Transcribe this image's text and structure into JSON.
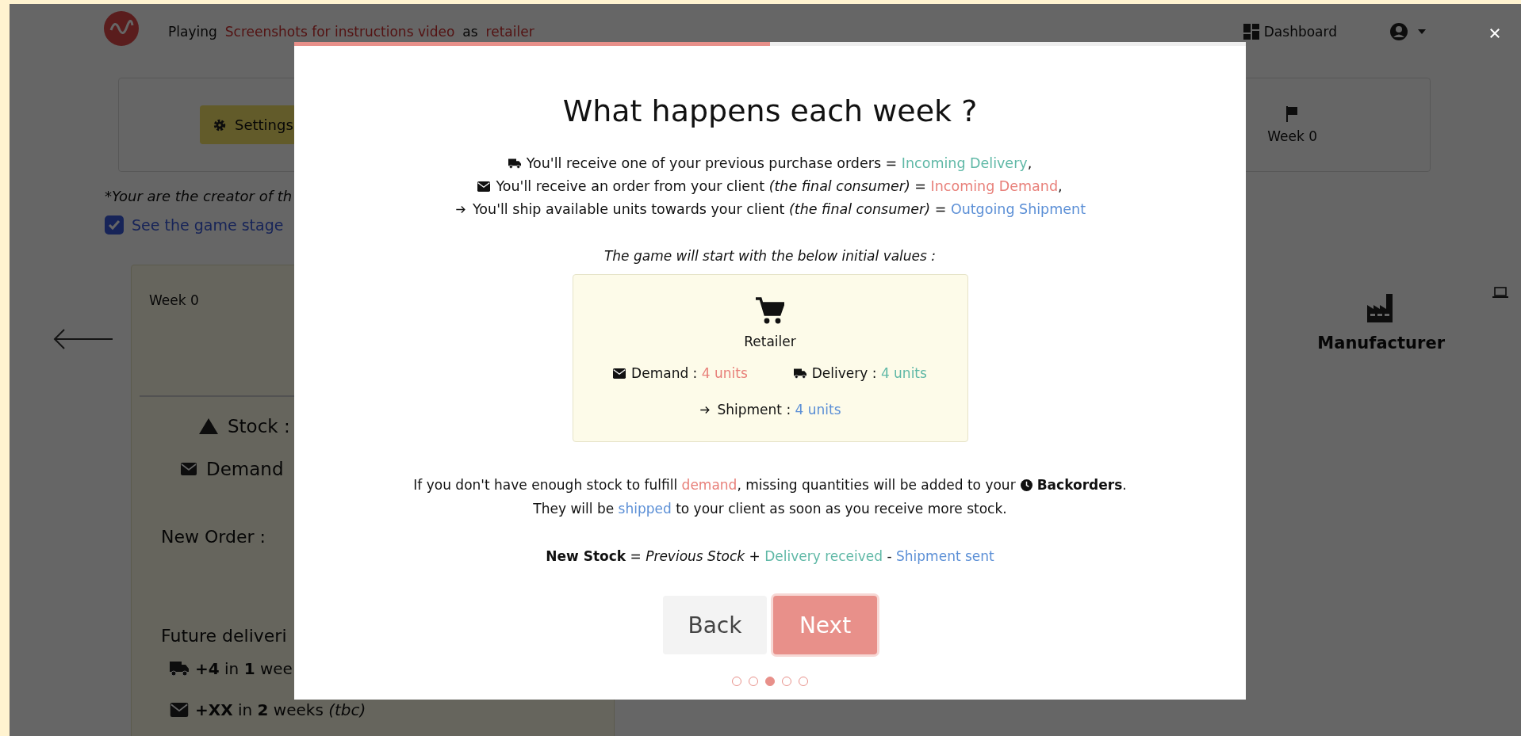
{
  "header": {
    "prefix": "Playing",
    "game": "Screenshots for instructions video",
    "joiner": "as",
    "role": "retailer",
    "dashboard": "Dashboard"
  },
  "settings_card": {
    "button": "Settings",
    "week": "Week 0"
  },
  "creator_note": "*Your are the creator of th",
  "stage_checkbox": {
    "label": "See the game stage",
    "checked": true
  },
  "game_card": {
    "week": "Week 0",
    "stock": "Stock :",
    "demand": "Demand",
    "new_order": "New Order :",
    "future": "Future deliveri",
    "deliveries": [
      {
        "kind": "truck",
        "text": "**+4** in **1** wee"
      },
      {
        "kind": "mail",
        "text": "**+XX** in **2** weeks *(tbc)*"
      }
    ]
  },
  "next_role": "Manufacturer",
  "modal": {
    "progress": {
      "level": 0.5
    },
    "title": "What happens each week ?",
    "events": [
      {
        "kind": "truck",
        "segments": [
          {
            "kind": "plain",
            "text": "You'll receive one of your previous purchase orders = "
          },
          {
            "kind": "delivery",
            "text": "Incoming Delivery"
          },
          {
            "kind": "plain",
            "text": ","
          }
        ]
      },
      {
        "kind": "mail",
        "segments": [
          {
            "kind": "plain",
            "text": "You'll receive an order from your client "
          },
          {
            "kind": "italic",
            "text": "(the final consumer)"
          },
          {
            "kind": "plain",
            "text": " = "
          },
          {
            "kind": "demand",
            "text": "Incoming Demand"
          },
          {
            "kind": "plain",
            "text": ","
          }
        ]
      },
      {
        "kind": "arrow",
        "segments": [
          {
            "kind": "plain",
            "text": "You'll ship available units towards your client "
          },
          {
            "kind": "italic",
            "text": "(the final consumer)"
          },
          {
            "kind": "plain",
            "text": " = "
          },
          {
            "kind": "shipment",
            "text": "Outgoing Shipment"
          }
        ]
      }
    ],
    "caption": "The game will start with the below initial values :",
    "initial": {
      "role": "Retailer",
      "values": [
        {
          "kind": "mail",
          "segments": [
            {
              "kind": "plain",
              "text": "Demand : "
            },
            {
              "kind": "demand",
              "text": "4 units"
            }
          ]
        },
        {
          "kind": "truck",
          "segments": [
            {
              "kind": "plain",
              "text": "Delivery : "
            },
            {
              "kind": "delivery",
              "text": "4 units"
            }
          ]
        },
        {
          "kind": "arrow",
          "segments": [
            {
              "kind": "plain",
              "text": "Shipment : "
            },
            {
              "kind": "shipment",
              "text": "4 units"
            }
          ]
        }
      ]
    },
    "backorder_lead": [
      {
        "kind": "plain",
        "text": "If you don't have enough stock to fulfill "
      },
      {
        "kind": "demand",
        "text": "demand"
      },
      {
        "kind": "plain",
        "text": ", missing quantities will be added to your"
      }
    ],
    "backorder_term": [
      {
        "kind": "strong",
        "text": "Backorders"
      },
      {
        "kind": "plain",
        "text": "."
      }
    ],
    "shipped_line": [
      {
        "kind": "plain",
        "text": "They will be "
      },
      {
        "kind": "shipment",
        "text": "shipped"
      },
      {
        "kind": "plain",
        "text": " to your client as soon as you receive more stock."
      }
    ],
    "formula": [
      {
        "kind": "strong",
        "text": "New Stock"
      },
      {
        "kind": "plain",
        "text": " = "
      },
      {
        "kind": "italic",
        "text": "Previous Stock"
      },
      {
        "kind": "plain",
        "text": " + "
      },
      {
        "kind": "delivery",
        "text": "Delivery received"
      },
      {
        "kind": "plain",
        "text": " - "
      },
      {
        "kind": "shipment",
        "text": "Shipment sent"
      }
    ],
    "back": "Back",
    "next": "Next",
    "steps": [
      {
        "selected": false
      },
      {
        "selected": false
      },
      {
        "selected": true
      },
      {
        "selected": false
      },
      {
        "selected": false
      }
    ]
  }
}
